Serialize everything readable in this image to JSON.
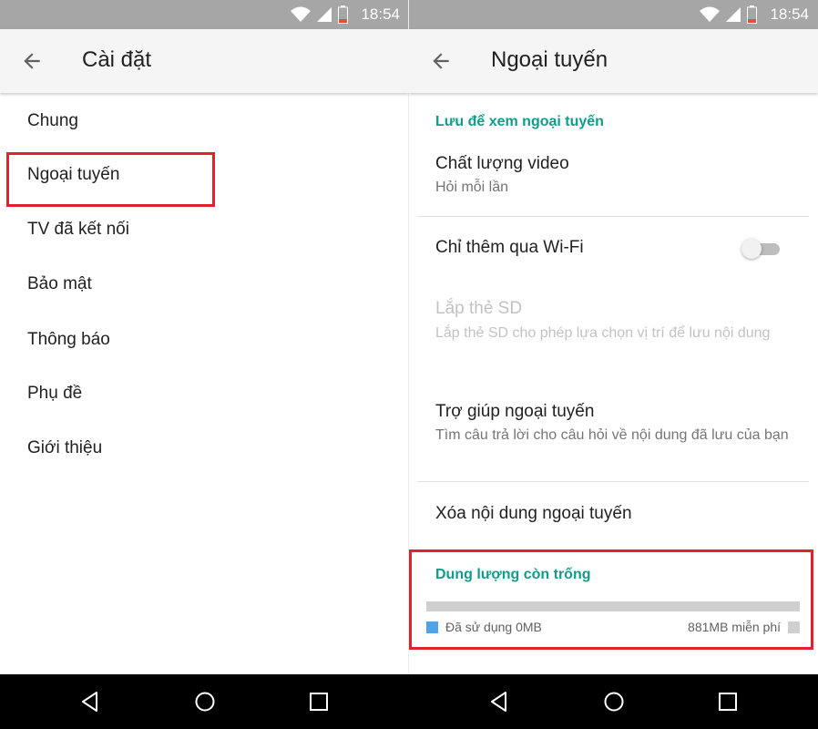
{
  "status_bar": {
    "time": "18:54",
    "icons": [
      "wifi-icon",
      "signal-icon",
      "battery-icon"
    ]
  },
  "left": {
    "title": "Cài đặt",
    "menu": [
      "Chung",
      "Ngoại tuyến",
      "TV đã kết nối",
      "Bảo mật",
      "Thông báo",
      "Phụ đề",
      "Giới thiệu"
    ],
    "highlighted_item": "Ngoại tuyến"
  },
  "right": {
    "title": "Ngoại tuyến",
    "section_save": "Lưu để xem ngoại tuyến",
    "video_quality": {
      "title": "Chất lượng video",
      "subtitle": "Hỏi mỗi lần"
    },
    "wifi_only": {
      "title": "Chỉ thêm qua Wi-Fi",
      "enabled": false
    },
    "sd_card": {
      "title": "Lắp thẻ SD",
      "subtitle": "Lắp thẻ SD cho phép lựa chọn vị trí để lưu nội dung",
      "disabled": true
    },
    "offline_help": {
      "title": "Trợ giúp ngoại tuyến",
      "subtitle": "Tìm câu trả lời cho câu hỏi về nội dung đã lưu của bạn"
    },
    "delete_offline": {
      "title": "Xóa nội dung ngoại tuyến"
    },
    "storage": {
      "header": "Dung lượng còn trống",
      "used_label": "Đã sử dụng 0MB",
      "free_label": "881MB miễn phí",
      "used_fraction": 0
    }
  },
  "colors": {
    "accent": "#0f9d8a",
    "highlight_border": "#e0222c",
    "status_bar": "#a6a6a6",
    "used_swatch": "#4fa3e8",
    "free_swatch": "#cfcfcf"
  },
  "nav_bar": {
    "icons": [
      "back-triangle-icon",
      "home-circle-icon",
      "recents-square-icon"
    ]
  }
}
